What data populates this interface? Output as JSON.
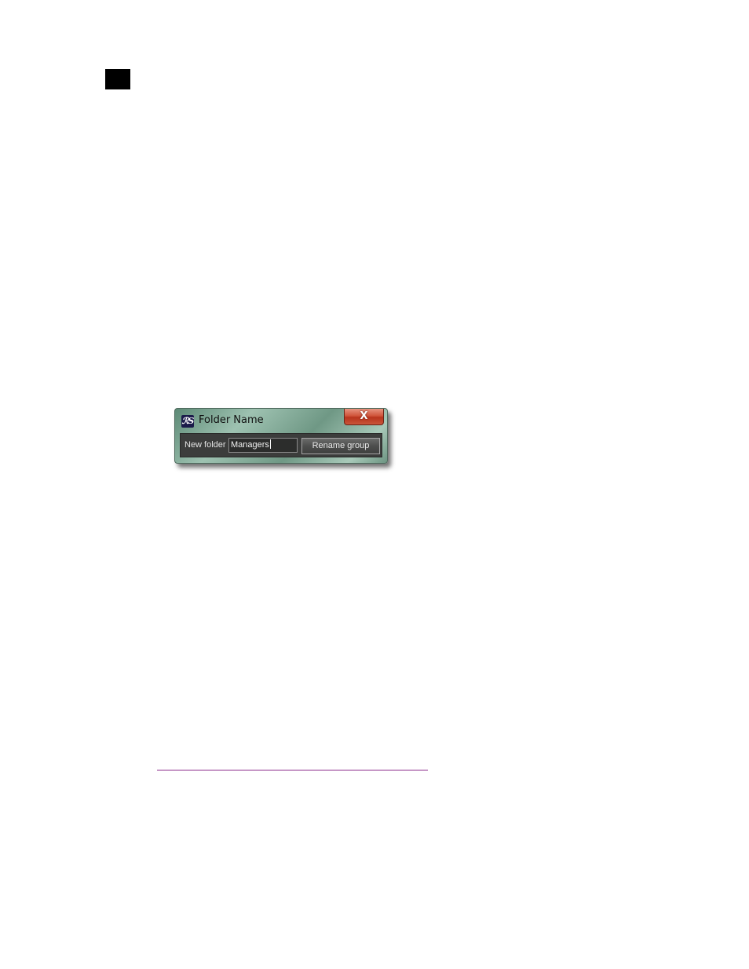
{
  "dialog": {
    "title": "Folder Name",
    "app_icon_text": "ℛS",
    "close_label": "X",
    "field_label": "New folder",
    "field_value": "Managers",
    "button_label": "Rename group"
  },
  "colors": {
    "dialog_frame": "#7ea896",
    "client_bg": "#3c3d3c",
    "close_button": "#c9452b",
    "rule": "#8b2a8b"
  }
}
